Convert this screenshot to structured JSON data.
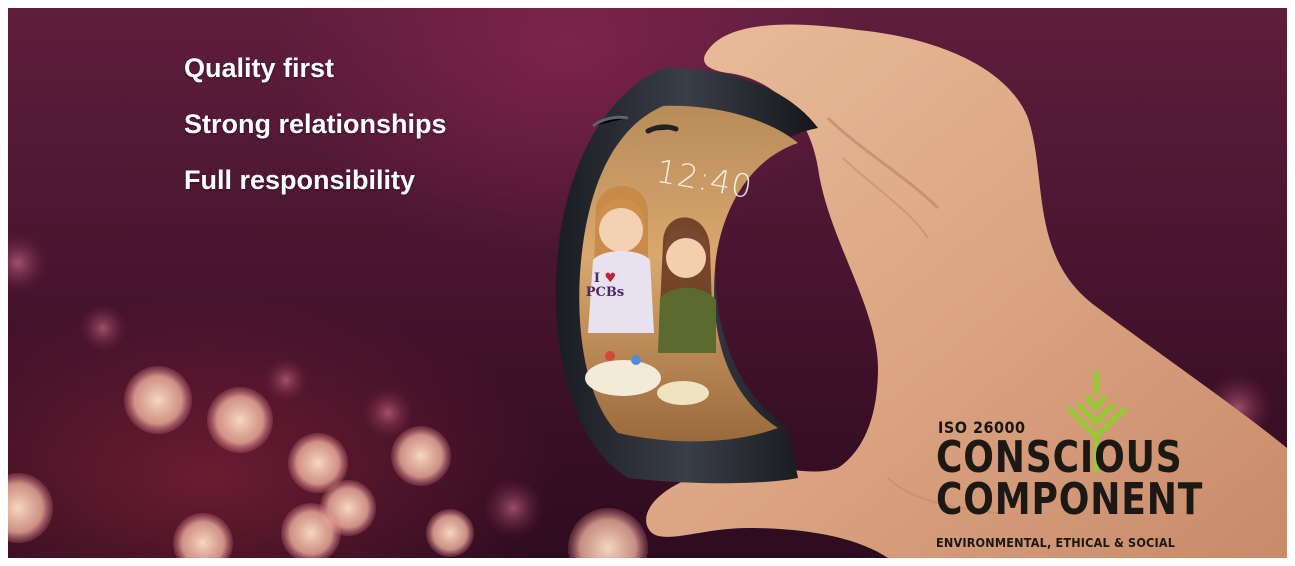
{
  "taglines": [
    "Quality first",
    "Strong relationships",
    "Full responsibility"
  ],
  "phone": {
    "clock": "12:40",
    "shirt_line1": "I",
    "shirt_heart": "♥",
    "shirt_line2": "PCBs"
  },
  "logo": {
    "standard": "ISO 26000",
    "line1": "CONSCIOUS",
    "line2": "COMPONENT",
    "subtitle": "ENVIRONMENTAL, ETHICAL & SOCIAL",
    "icon": "tree-icon",
    "accent": "#9cc53a"
  },
  "colors": {
    "background_top": "#5e1e3c",
    "background_bottom": "#2e0c1f",
    "text": "#ffffff"
  }
}
